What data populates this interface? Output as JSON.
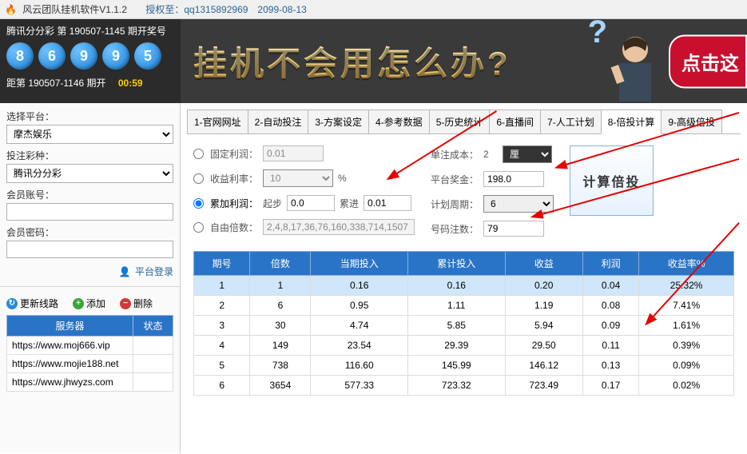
{
  "title": {
    "flame": "🔥",
    "version": "风云团队挂机软件V1.1.2",
    "auth": "授权至：qq1315892969　2099-08-13"
  },
  "lottery": {
    "title": "腾讯分分彩 第 190507-1145 期开奖号",
    "balls": [
      "8",
      "6",
      "9",
      "9",
      "5"
    ],
    "next": "距第 190507-1146 期开",
    "timer": "00:59"
  },
  "banner": {
    "text": "挂机不会用怎么办?",
    "cta": "点击这"
  },
  "sidebar": {
    "platform_label": "选择平台：",
    "platform_value": "摩杰娱乐",
    "lottery_label": "投注彩种：",
    "lottery_value": "腾讯分分彩",
    "account_label": "会员账号：",
    "password_label": "会员密码：",
    "login": "平台登录",
    "buttons": {
      "refresh": "更新线路",
      "add": "添加",
      "delete": "删除"
    },
    "srv_headers": [
      "服务器",
      "状态"
    ],
    "servers": [
      "https://www.moj666.vip",
      "https://www.mojie188.net",
      "https://www.jhwyzs.com"
    ]
  },
  "tabs": [
    "1-官网网址",
    "2-自动投注",
    "3-方案设定",
    "4-参考数据",
    "5-历史统计",
    "6-直播间",
    "7-人工计划",
    "8-倍投计算",
    "9-高级倍投"
  ],
  "active_tab": 7,
  "form": {
    "opt1": "固定利润：",
    "opt1_val": "0.01",
    "opt2": "收益利率：",
    "opt2_val": "10",
    "opt2_unit": "%",
    "opt3": "累加利润：",
    "opt3_a": "起步",
    "opt3_a_val": "0.0",
    "opt3_b": "累进",
    "opt3_b_val": "0.01",
    "opt4": "自由倍数：",
    "opt4_val": "2,4,8,17,36,76,160,338,714,1507",
    "unitcost": "单注成本：",
    "unitcost_val": "2",
    "unitcost_unit": "厘",
    "bonus": "平台奖金：",
    "bonus_val": "198.0",
    "period": "计划周期：",
    "period_val": "6",
    "betcount": "号码注数：",
    "betcount_val": "79",
    "calc": "计算倍投"
  },
  "table": {
    "headers": [
      "期号",
      "倍数",
      "当期投入",
      "累计投入",
      "收益",
      "利润",
      "收益率%"
    ],
    "rows": [
      [
        "1",
        "1",
        "0.16",
        "0.16",
        "0.20",
        "0.04",
        "25.32%"
      ],
      [
        "2",
        "6",
        "0.95",
        "1.11",
        "1.19",
        "0.08",
        "7.41%"
      ],
      [
        "3",
        "30",
        "4.74",
        "5.85",
        "5.94",
        "0.09",
        "1.61%"
      ],
      [
        "4",
        "149",
        "23.54",
        "29.39",
        "29.50",
        "0.11",
        "0.39%"
      ],
      [
        "5",
        "738",
        "116.60",
        "145.99",
        "146.12",
        "0.13",
        "0.09%"
      ],
      [
        "6",
        "3654",
        "577.33",
        "723.32",
        "723.49",
        "0.17",
        "0.02%"
      ]
    ]
  },
  "chart_data": {
    "type": "table",
    "title": "倍投计算",
    "columns": [
      "期号",
      "倍数",
      "当期投入",
      "累计投入",
      "收益",
      "利润",
      "收益率%"
    ],
    "rows": [
      [
        1,
        1,
        0.16,
        0.16,
        0.2,
        0.04,
        25.32
      ],
      [
        2,
        6,
        0.95,
        1.11,
        1.19,
        0.08,
        7.41
      ],
      [
        3,
        30,
        4.74,
        5.85,
        5.94,
        0.09,
        1.61
      ],
      [
        4,
        149,
        23.54,
        29.39,
        29.5,
        0.11,
        0.39
      ],
      [
        5,
        738,
        116.6,
        145.99,
        146.12,
        0.13,
        0.09
      ],
      [
        6,
        3654,
        577.33,
        723.32,
        723.49,
        0.17,
        0.02
      ]
    ]
  }
}
